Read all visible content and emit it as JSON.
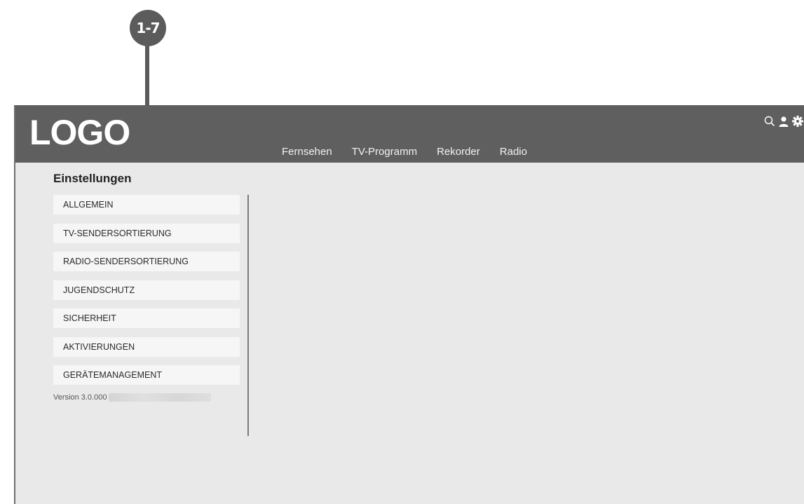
{
  "callout": {
    "label": "1-7"
  },
  "header": {
    "logo": "LOGO",
    "nav": [
      "Fernsehen",
      "TV-Programm",
      "Rekorder",
      "Radio"
    ],
    "icons": [
      "search-icon",
      "user-icon",
      "gear-icon"
    ]
  },
  "sidebar": {
    "title": "Einstellungen",
    "items": [
      {
        "label": "ALLGEMEIN"
      },
      {
        "label": "TV-SENDERSORTIERUNG"
      },
      {
        "label": "RADIO-SENDERSORTIERUNG"
      },
      {
        "label": "JUGENDSCHUTZ"
      },
      {
        "label": "SICHERHEIT"
      },
      {
        "label": "AKTIVIERUNGEN"
      },
      {
        "label": "GERÄTEMANAGEMENT"
      }
    ],
    "version": "Version 3.0.000"
  },
  "colors": {
    "header_bg": "#5f5f5f",
    "page_bg": "#e8e9e8",
    "menu_item_bg": "#f6f6f6",
    "callout": "#5b5b5b"
  }
}
